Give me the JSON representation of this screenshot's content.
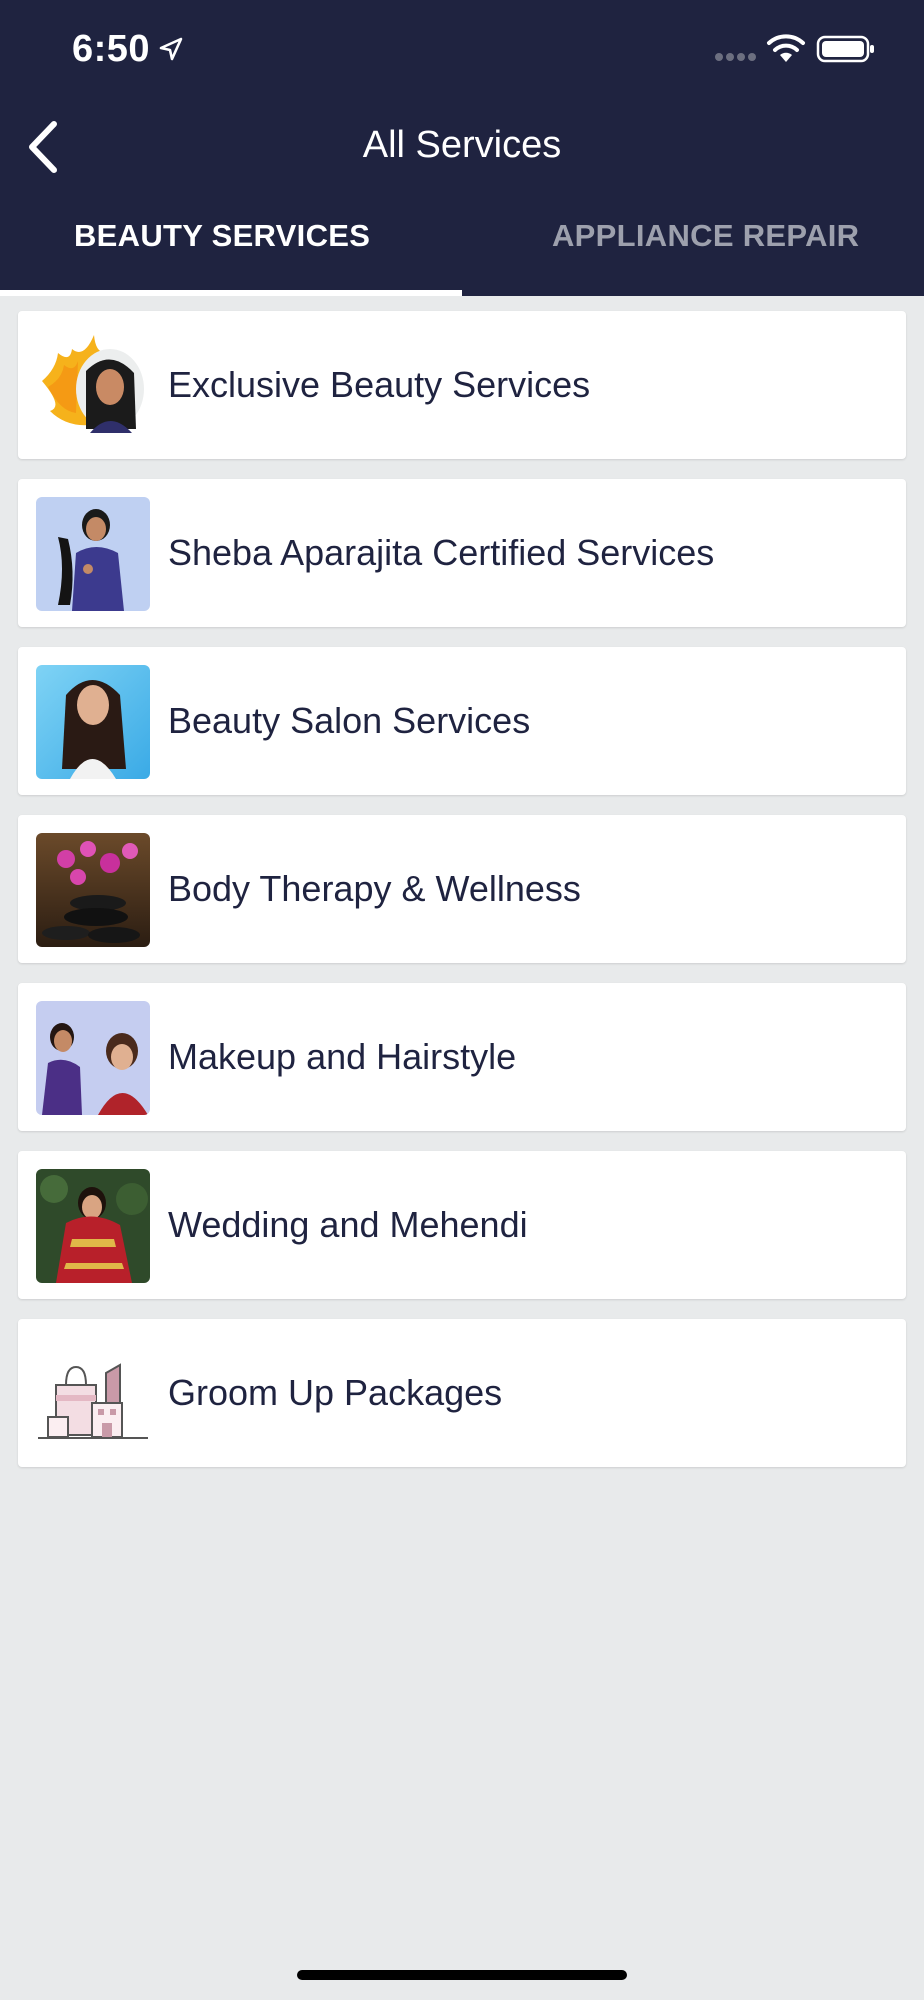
{
  "status_bar": {
    "time": "6:50"
  },
  "header": {
    "title": "All Services",
    "back_icon": "chevron-left-icon"
  },
  "tabs": [
    {
      "label": "BEAUTY SERVICES",
      "active": true
    },
    {
      "label": "APPLIANCE REPAIR",
      "active": false
    }
  ],
  "services": [
    {
      "label": "Exclusive Beauty Services"
    },
    {
      "label": "Sheba Aparajita Certified Services"
    },
    {
      "label": "Beauty Salon Services"
    },
    {
      "label": "Body Therapy & Wellness"
    },
    {
      "label": "Makeup and Hairstyle"
    },
    {
      "label": "Wedding and Mehendi"
    },
    {
      "label": "Groom Up Packages"
    }
  ],
  "colors": {
    "header_bg": "#1f2340",
    "page_bg": "#e8eaeb",
    "active_tab": "#ffffff",
    "inactive_tab": "#9da0ad",
    "item_text": "#1f2340"
  }
}
